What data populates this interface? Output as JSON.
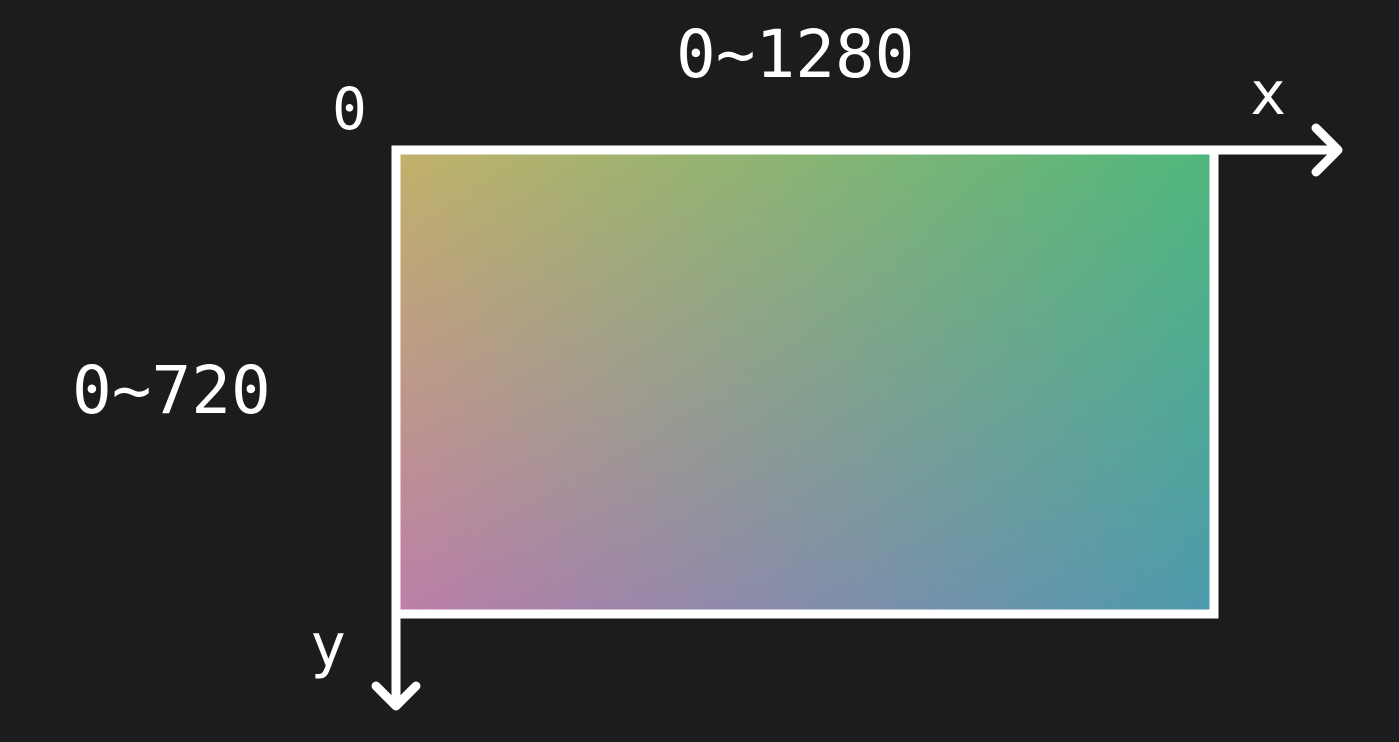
{
  "labels": {
    "origin": "0",
    "width_range": "0~1280",
    "height_range": "0~720",
    "x_axis": "x",
    "y_axis": "y"
  },
  "colors": {
    "background": "#1b1c1e",
    "stroke": "#ffffff",
    "gradient_top_left": "#c2b26a",
    "gradient_top_right": "#4fb87c",
    "gradient_bottom_left": "#bd7ea9",
    "gradient_bottom_right": "#4c9aad"
  }
}
